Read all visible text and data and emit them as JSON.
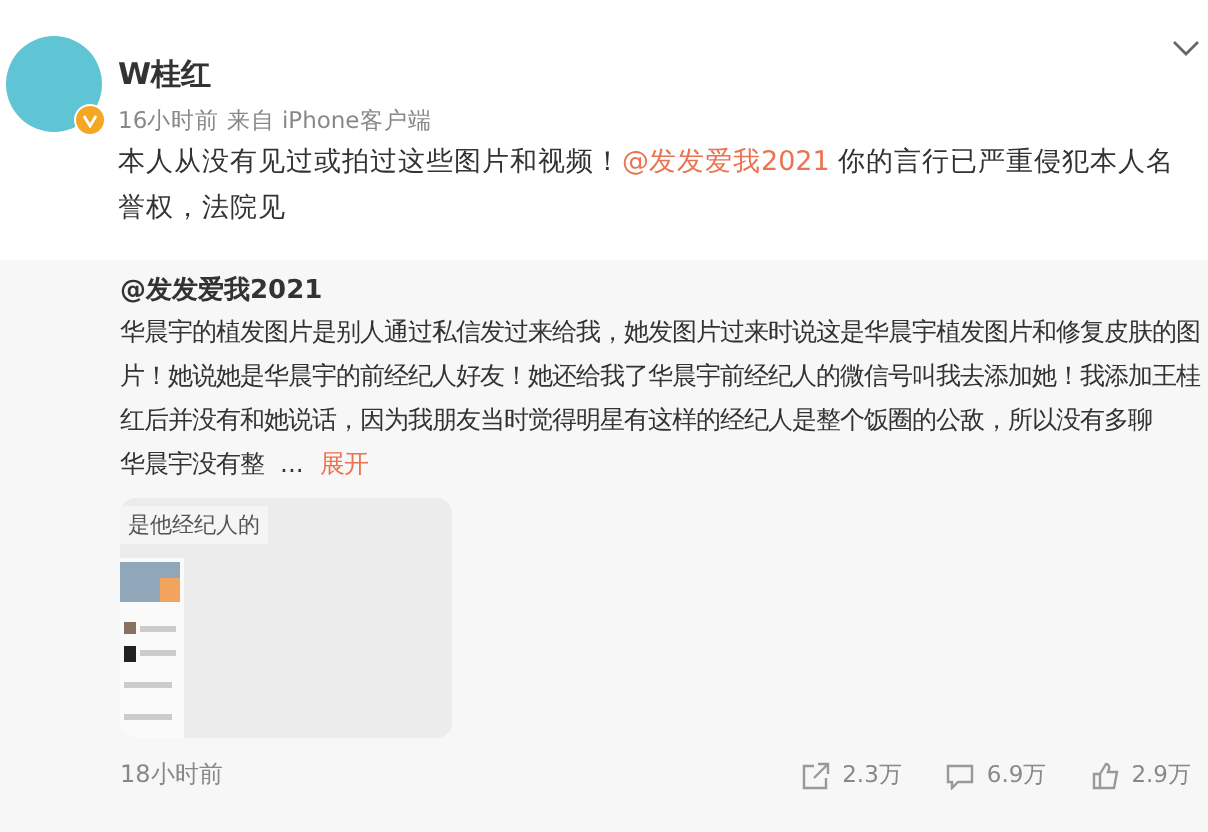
{
  "post": {
    "author": "W桂红",
    "verified": true,
    "meta": "16小时前 来自 iPhone客户端",
    "text_before": "本人从没有见过或拍过这些图片和视频！",
    "mention": "@发发爱我2021",
    "text_after": " 你的言行已严重侵犯本人名誉权，法院见"
  },
  "repost": {
    "author": "@发发爱我2021",
    "text": "华晨宇的植发图片是别人通过私信发过来给我，她发图片过来时说这是华晨宇植发图片和修复皮肤的图片！她说她是华晨宇的前经纪人好友！她还给我了华晨宇前经纪人的微信号叫我去添加她！我添加王桂红后并没有和她说话，因为我朋友当时觉得明星有这样的经纪人是整个饭圈的公敌，所以没有多聊",
    "text_tail": "华晨宇没有整",
    "ellipsis": "...",
    "more": "展开",
    "image_caption": "是他经纪人的",
    "time": "18小时前",
    "actions": [
      {
        "kind": "forward",
        "count": "2.3万"
      },
      {
        "kind": "comment",
        "count": "6.9万"
      },
      {
        "kind": "like",
        "count": "2.9万"
      }
    ]
  }
}
